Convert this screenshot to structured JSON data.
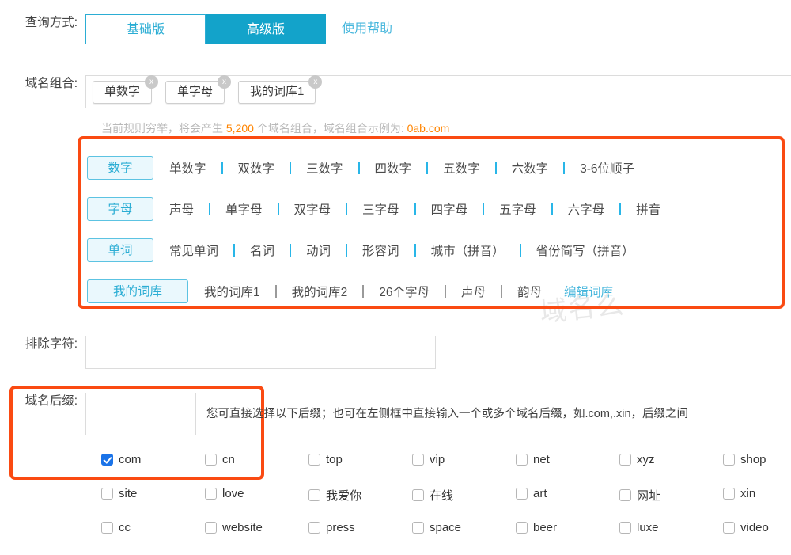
{
  "query_mode": {
    "label": "查询方式:",
    "tabs": [
      {
        "label": "基础版",
        "active": false
      },
      {
        "label": "高级版",
        "active": true
      }
    ],
    "help_link": "使用帮助"
  },
  "domain_combo": {
    "label": "域名组合:",
    "chips": [
      {
        "label": "单数字",
        "remove": "x"
      },
      {
        "label": "单字母",
        "remove": "x"
      },
      {
        "label": "我的词库1",
        "remove": "x"
      }
    ],
    "hint": {
      "prefix": "当前规则穷举，将会产生 ",
      "count": "5,200",
      "middle": " 个域名组合，域名组合示例为:  ",
      "example": "0ab.com"
    }
  },
  "rules": [
    {
      "category": "数字",
      "items": [
        "单数字",
        "双数字",
        "三数字",
        "四数字",
        "五数字",
        "六数字",
        "3-6位顺子"
      ],
      "separator_color": "blue",
      "edit_link": ""
    },
    {
      "category": "字母",
      "items": [
        "声母",
        "单字母",
        "双字母",
        "三字母",
        "四字母",
        "五字母",
        "六字母",
        "拼音"
      ],
      "separator_color": "blue",
      "edit_link": ""
    },
    {
      "category": "单词",
      "items": [
        "常见单词",
        "名词",
        "动词",
        "形容词",
        "城市（拼音）",
        "省份简写（拼音）"
      ],
      "separator_color": "blue",
      "edit_link": ""
    },
    {
      "category": "我的词库",
      "items": [
        "我的词库1",
        "我的词库2",
        "26个字母",
        "声母",
        "韵母"
      ],
      "separator_color": "gray",
      "edit_link": "编辑词库"
    }
  ],
  "exclude": {
    "label": "排除字符:",
    "value": "",
    "placeholder": ""
  },
  "suffix": {
    "label": "域名后缀:",
    "value": "",
    "placeholder": "",
    "help_text": "您可直接选择以下后缀；也可在左侧框中直接输入一个或多个域名后缀，如.com,.xin，后缀之间"
  },
  "suffix_checkboxes": [
    [
      {
        "label": "com",
        "checked": true
      },
      {
        "label": "cn",
        "checked": false
      },
      {
        "label": "top",
        "checked": false
      },
      {
        "label": "vip",
        "checked": false
      },
      {
        "label": "net",
        "checked": false
      },
      {
        "label": "xyz",
        "checked": false
      },
      {
        "label": "shop",
        "checked": false
      }
    ],
    [
      {
        "label": "site",
        "checked": false
      },
      {
        "label": "love",
        "checked": false
      },
      {
        "label": "我爱你",
        "checked": false
      },
      {
        "label": "在线",
        "checked": false
      },
      {
        "label": "art",
        "checked": false
      },
      {
        "label": "网址",
        "checked": false
      },
      {
        "label": "xin",
        "checked": false
      }
    ],
    [
      {
        "label": "cc",
        "checked": false
      },
      {
        "label": "website",
        "checked": false
      },
      {
        "label": "press",
        "checked": false
      },
      {
        "label": "space",
        "checked": false
      },
      {
        "label": "beer",
        "checked": false
      },
      {
        "label": "luxe",
        "checked": false
      },
      {
        "label": "video",
        "checked": false
      }
    ]
  ],
  "watermark": "域名么",
  "colors": {
    "accent_blue": "#13a3ca",
    "link_blue": "#45b6dc",
    "highlight_red": "#fa4a12",
    "hint_orange": "#ff8400",
    "checkbox_blue": "#1a73e8"
  }
}
